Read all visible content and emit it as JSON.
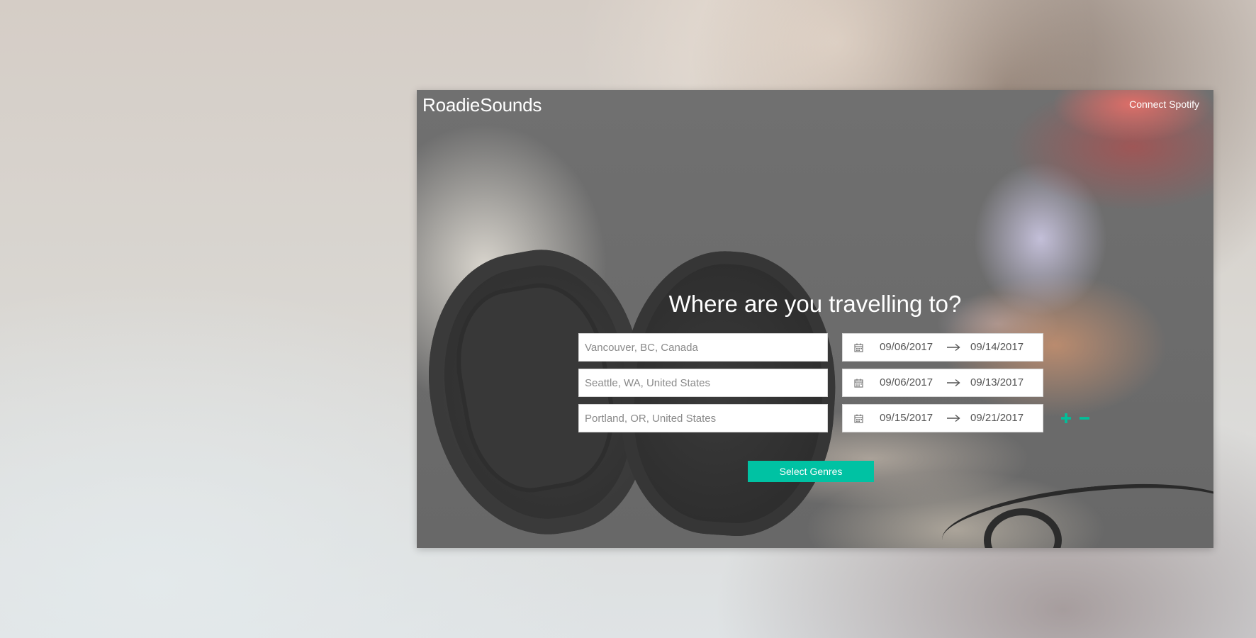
{
  "app": {
    "name": "RoadieSounds",
    "connect_label": "Connect Spotify"
  },
  "main": {
    "headline": "Where are you travelling to?",
    "trips": [
      {
        "location": "Vancouver, BC, Canada",
        "start_date": "09/06/2017",
        "end_date": "09/14/2017"
      },
      {
        "location": "Seattle, WA, United States",
        "start_date": "09/06/2017",
        "end_date": "09/13/2017"
      },
      {
        "location": "Portland, OR, United States",
        "start_date": "09/15/2017",
        "end_date": "09/21/2017"
      }
    ],
    "controls": {
      "add_label": "+",
      "remove_label": "−"
    },
    "cta_label": "Select Genres"
  },
  "colors": {
    "accent": "#00c2a3",
    "header_text": "#ffffff",
    "overlay": "#6b6b6b"
  },
  "icons": {
    "calendar": "calendar-icon",
    "arrow": "arrow-right-icon",
    "add": "plus-icon",
    "remove": "minus-icon"
  }
}
